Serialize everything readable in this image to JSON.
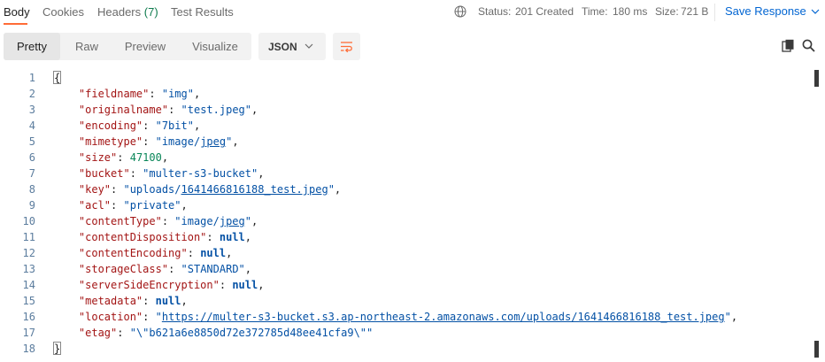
{
  "tabs": [
    {
      "label": "Body",
      "active": true
    },
    {
      "label": "Cookies",
      "active": false
    },
    {
      "label": "Headers",
      "count": "(7)",
      "active": false
    },
    {
      "label": "Test Results",
      "active": false
    }
  ],
  "status": {
    "status_label": "Status:",
    "status_value": "201 Created",
    "time_label": "Time:",
    "time_value": "180 ms",
    "size_label": "Size:",
    "size_value": "721 B"
  },
  "save_response_label": "Save Response",
  "view_modes": [
    "Pretty",
    "Raw",
    "Preview",
    "Visualize"
  ],
  "format_select": "JSON",
  "colors": {
    "accent": "#ff6c37",
    "status_green": "#0f7b4e",
    "link_blue": "#0265d2"
  },
  "code_lines": [
    {
      "n": "1",
      "parts": [
        {
          "t": "{",
          "c": "brace"
        }
      ]
    },
    {
      "n": "2",
      "parts": [
        {
          "t": "    ",
          "c": "punc"
        },
        {
          "t": "\"fieldname\"",
          "c": "key"
        },
        {
          "t": ": ",
          "c": "punc"
        },
        {
          "t": "\"img\"",
          "c": "str"
        },
        {
          "t": ",",
          "c": "punc"
        }
      ]
    },
    {
      "n": "3",
      "parts": [
        {
          "t": "    ",
          "c": "punc"
        },
        {
          "t": "\"originalname\"",
          "c": "key"
        },
        {
          "t": ": ",
          "c": "punc"
        },
        {
          "t": "\"test.jpeg\"",
          "c": "str"
        },
        {
          "t": ",",
          "c": "punc"
        }
      ]
    },
    {
      "n": "4",
      "parts": [
        {
          "t": "    ",
          "c": "punc"
        },
        {
          "t": "\"encoding\"",
          "c": "key"
        },
        {
          "t": ": ",
          "c": "punc"
        },
        {
          "t": "\"7bit\"",
          "c": "str"
        },
        {
          "t": ",",
          "c": "punc"
        }
      ]
    },
    {
      "n": "5",
      "parts": [
        {
          "t": "    ",
          "c": "punc"
        },
        {
          "t": "\"mimetype\"",
          "c": "key"
        },
        {
          "t": ": ",
          "c": "punc"
        },
        {
          "t": "\"image/",
          "c": "str"
        },
        {
          "t": "jpeg",
          "c": "str url"
        },
        {
          "t": "\"",
          "c": "str"
        },
        {
          "t": ",",
          "c": "punc"
        }
      ]
    },
    {
      "n": "6",
      "parts": [
        {
          "t": "    ",
          "c": "punc"
        },
        {
          "t": "\"size\"",
          "c": "key"
        },
        {
          "t": ": ",
          "c": "punc"
        },
        {
          "t": "47100",
          "c": "num"
        },
        {
          "t": ",",
          "c": "punc"
        }
      ]
    },
    {
      "n": "7",
      "parts": [
        {
          "t": "    ",
          "c": "punc"
        },
        {
          "t": "\"bucket\"",
          "c": "key"
        },
        {
          "t": ": ",
          "c": "punc"
        },
        {
          "t": "\"multer-s3-bucket\"",
          "c": "str"
        },
        {
          "t": ",",
          "c": "punc"
        }
      ]
    },
    {
      "n": "8",
      "parts": [
        {
          "t": "    ",
          "c": "punc"
        },
        {
          "t": "\"key\"",
          "c": "key"
        },
        {
          "t": ": ",
          "c": "punc"
        },
        {
          "t": "\"uploads/",
          "c": "str"
        },
        {
          "t": "1641466816188_test.jpeg",
          "c": "str url"
        },
        {
          "t": "\"",
          "c": "str"
        },
        {
          "t": ",",
          "c": "punc"
        }
      ]
    },
    {
      "n": "9",
      "parts": [
        {
          "t": "    ",
          "c": "punc"
        },
        {
          "t": "\"acl\"",
          "c": "key"
        },
        {
          "t": ": ",
          "c": "punc"
        },
        {
          "t": "\"private\"",
          "c": "str"
        },
        {
          "t": ",",
          "c": "punc"
        }
      ]
    },
    {
      "n": "10",
      "parts": [
        {
          "t": "    ",
          "c": "punc"
        },
        {
          "t": "\"contentType\"",
          "c": "key"
        },
        {
          "t": ": ",
          "c": "punc"
        },
        {
          "t": "\"image/",
          "c": "str"
        },
        {
          "t": "jpeg",
          "c": "str url"
        },
        {
          "t": "\"",
          "c": "str"
        },
        {
          "t": ",",
          "c": "punc"
        }
      ]
    },
    {
      "n": "11",
      "parts": [
        {
          "t": "    ",
          "c": "punc"
        },
        {
          "t": "\"contentDisposition\"",
          "c": "key"
        },
        {
          "t": ": ",
          "c": "punc"
        },
        {
          "t": "null",
          "c": "kw"
        },
        {
          "t": ",",
          "c": "punc"
        }
      ]
    },
    {
      "n": "12",
      "parts": [
        {
          "t": "    ",
          "c": "punc"
        },
        {
          "t": "\"contentEncoding\"",
          "c": "key"
        },
        {
          "t": ": ",
          "c": "punc"
        },
        {
          "t": "null",
          "c": "kw"
        },
        {
          "t": ",",
          "c": "punc"
        }
      ]
    },
    {
      "n": "13",
      "parts": [
        {
          "t": "    ",
          "c": "punc"
        },
        {
          "t": "\"storageClass\"",
          "c": "key"
        },
        {
          "t": ": ",
          "c": "punc"
        },
        {
          "t": "\"STANDARD\"",
          "c": "str"
        },
        {
          "t": ",",
          "c": "punc"
        }
      ]
    },
    {
      "n": "14",
      "parts": [
        {
          "t": "    ",
          "c": "punc"
        },
        {
          "t": "\"serverSideEncryption\"",
          "c": "key"
        },
        {
          "t": ": ",
          "c": "punc"
        },
        {
          "t": "null",
          "c": "kw"
        },
        {
          "t": ",",
          "c": "punc"
        }
      ]
    },
    {
      "n": "15",
      "parts": [
        {
          "t": "    ",
          "c": "punc"
        },
        {
          "t": "\"metadata\"",
          "c": "key"
        },
        {
          "t": ": ",
          "c": "punc"
        },
        {
          "t": "null",
          "c": "kw"
        },
        {
          "t": ",",
          "c": "punc"
        }
      ]
    },
    {
      "n": "16",
      "parts": [
        {
          "t": "    ",
          "c": "punc"
        },
        {
          "t": "\"location\"",
          "c": "key"
        },
        {
          "t": ": ",
          "c": "punc"
        },
        {
          "t": "\"",
          "c": "str"
        },
        {
          "t": "https://multer-s3-bucket.s3.ap-northeast-2.amazonaws.com/uploads/1641466816188_test.jpeg",
          "c": "str url"
        },
        {
          "t": "\"",
          "c": "str"
        },
        {
          "t": ",",
          "c": "punc"
        }
      ]
    },
    {
      "n": "17",
      "parts": [
        {
          "t": "    ",
          "c": "punc"
        },
        {
          "t": "\"etag\"",
          "c": "key"
        },
        {
          "t": ": ",
          "c": "punc"
        },
        {
          "t": "\"\\\"b621a6e8850d72e372785d48ee41cfa9\\\"\"",
          "c": "str"
        }
      ]
    },
    {
      "n": "18",
      "parts": [
        {
          "t": "}",
          "c": "brace"
        }
      ]
    }
  ]
}
